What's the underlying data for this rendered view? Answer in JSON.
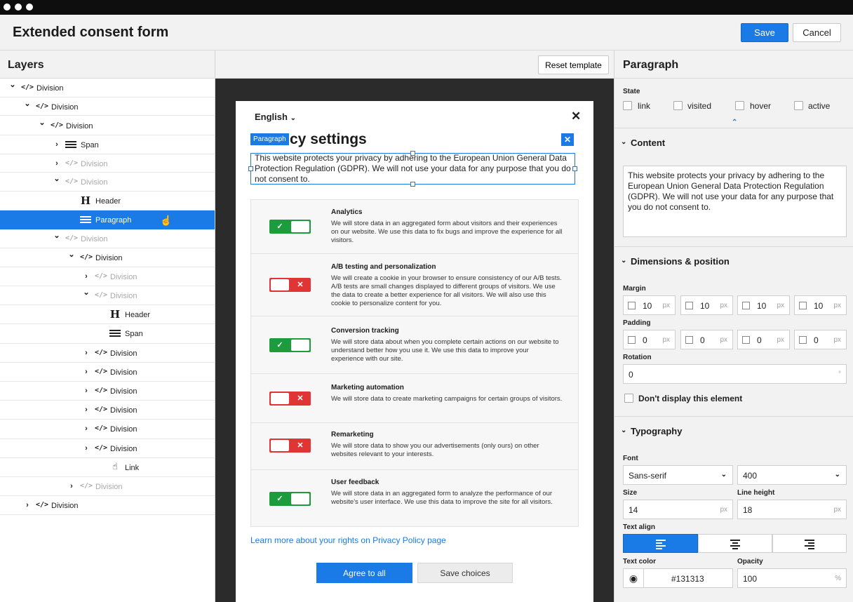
{
  "app": {
    "title": "Extended consent form",
    "save_label": "Save",
    "cancel_label": "Cancel"
  },
  "layers": {
    "title": "Layers",
    "items": [
      {
        "label": "Division",
        "icon": "code-icon",
        "chevron": "down",
        "depth": 0,
        "dim": false,
        "selected": false
      },
      {
        "label": "Division",
        "icon": "code-icon",
        "chevron": "down",
        "depth": 1,
        "dim": false,
        "selected": false
      },
      {
        "label": "Division",
        "icon": "code-icon",
        "chevron": "down",
        "depth": 2,
        "dim": false,
        "selected": false
      },
      {
        "label": "Span",
        "icon": "text-lines-icon",
        "chevron": "right",
        "depth": 3,
        "dim": false,
        "selected": false
      },
      {
        "label": "Division",
        "icon": "code-icon",
        "chevron": "right",
        "depth": 3,
        "dim": true,
        "selected": false
      },
      {
        "label": "Division",
        "icon": "code-icon",
        "chevron": "down",
        "depth": 3,
        "dim": true,
        "selected": false
      },
      {
        "label": "Header",
        "icon": "heading-icon",
        "chevron": "",
        "depth": 4,
        "dim": false,
        "selected": false
      },
      {
        "label": "Paragraph",
        "icon": "text-lines-icon",
        "chevron": "",
        "depth": 4,
        "dim": false,
        "selected": true
      },
      {
        "label": "Division",
        "icon": "code-icon",
        "chevron": "down",
        "depth": 3,
        "dim": true,
        "selected": false
      },
      {
        "label": "Division",
        "icon": "code-icon",
        "chevron": "down",
        "depth": 4,
        "dim": false,
        "selected": false
      },
      {
        "label": "Division",
        "icon": "code-icon",
        "chevron": "right",
        "depth": 5,
        "dim": true,
        "selected": false
      },
      {
        "label": "Division",
        "icon": "code-icon",
        "chevron": "down",
        "depth": 5,
        "dim": true,
        "selected": false
      },
      {
        "label": "Header",
        "icon": "heading-icon",
        "chevron": "",
        "depth": 6,
        "dim": false,
        "selected": false
      },
      {
        "label": "Span",
        "icon": "text-lines-icon",
        "chevron": "",
        "depth": 6,
        "dim": false,
        "selected": false
      },
      {
        "label": "Division",
        "icon": "code-icon",
        "chevron": "right",
        "depth": 5,
        "dim": false,
        "selected": false
      },
      {
        "label": "Division",
        "icon": "code-icon",
        "chevron": "right",
        "depth": 5,
        "dim": false,
        "selected": false
      },
      {
        "label": "Division",
        "icon": "code-icon",
        "chevron": "right",
        "depth": 5,
        "dim": false,
        "selected": false
      },
      {
        "label": "Division",
        "icon": "code-icon",
        "chevron": "right",
        "depth": 5,
        "dim": false,
        "selected": false
      },
      {
        "label": "Division",
        "icon": "code-icon",
        "chevron": "right",
        "depth": 5,
        "dim": false,
        "selected": false
      },
      {
        "label": "Division",
        "icon": "code-icon",
        "chevron": "right",
        "depth": 5,
        "dim": false,
        "selected": false
      },
      {
        "label": "Link",
        "icon": "pointer-hand-icon",
        "chevron": "",
        "depth": 6,
        "dim": false,
        "selected": false
      },
      {
        "label": "Division",
        "icon": "code-icon",
        "chevron": "right",
        "depth": 4,
        "dim": true,
        "selected": false
      },
      {
        "label": "Division",
        "icon": "code-icon",
        "chevron": "right",
        "depth": 1,
        "dim": false,
        "selected": false
      }
    ]
  },
  "canvas": {
    "reset_label": "Reset template",
    "language": "English",
    "selection_tag": "Paragraph",
    "heading_visible": "cy settings",
    "paragraph": "This website protects your privacy by adhering to the European Union General Data Protection Regulation (GDPR). We will not use your data for any purpose that you do not consent to.",
    "consents": [
      {
        "title": "Analytics",
        "enabled": true,
        "desc": "We will store data in an aggregated form about visitors and their experiences on our website. We use this data to fix bugs and improve the experience for all visitors."
      },
      {
        "title": "A/B testing and personalization",
        "enabled": false,
        "desc": "We will create a cookie in your browser to ensure consistency of our A/B tests. A/B tests are small changes displayed to different groups of visitors. We use the data to create a better experience for all visitors. We will also use this cookie to personalize content for you."
      },
      {
        "title": "Conversion tracking",
        "enabled": true,
        "desc": "We will store data about when you complete certain actions on our website to understand better how you use it. We use this data to improve your experience with our site."
      },
      {
        "title": "Marketing automation",
        "enabled": false,
        "desc": "We will store data to create marketing campaigns for certain groups of visitors."
      },
      {
        "title": "Remarketing",
        "enabled": false,
        "desc": "We will store data to show you our advertisements (only ours) on other websites relevant to your interests."
      },
      {
        "title": "User feedback",
        "enabled": true,
        "desc": "We will store data in an aggregated form to analyze the performance of our website's user interface. We use this data to improve the site for all visitors."
      }
    ],
    "learn_more": "Learn more about your rights on Privacy Policy page",
    "agree_label": "Agree to all",
    "save_choices_label": "Save choices"
  },
  "props": {
    "title": "Paragraph",
    "state_label": "State",
    "states": [
      "link",
      "visited",
      "hover",
      "active"
    ],
    "content_title": "Content",
    "content_text": "This website protects your privacy by adhering to the European Union General Data Protection Regulation (GDPR). We will not use your data for any purpose that you do not consent to.",
    "dims_title": "Dimensions & position",
    "margin_label": "Margin",
    "margin": [
      "10",
      "10",
      "10",
      "10"
    ],
    "padding_label": "Padding",
    "padding": [
      "0",
      "0",
      "0",
      "0"
    ],
    "unit": "px",
    "rotation_label": "Rotation",
    "rotation": "0",
    "rotation_unit": "°",
    "hide_label": "Don't display this element",
    "typo_title": "Typography",
    "font_label": "Font",
    "font_value": "Sans-serif",
    "weight_value": "400",
    "size_label": "Size",
    "size_value": "14",
    "lineheight_label": "Line height",
    "lineheight_value": "18",
    "align_label": "Text align",
    "color_label": "Text color",
    "color_value": "#131313",
    "opacity_label": "Opacity",
    "opacity_value": "100",
    "opacity_unit": "%"
  },
  "colors": {
    "accent": "#1a7be6",
    "toggle_on": "#1d9c3d",
    "toggle_off": "#e03535"
  }
}
